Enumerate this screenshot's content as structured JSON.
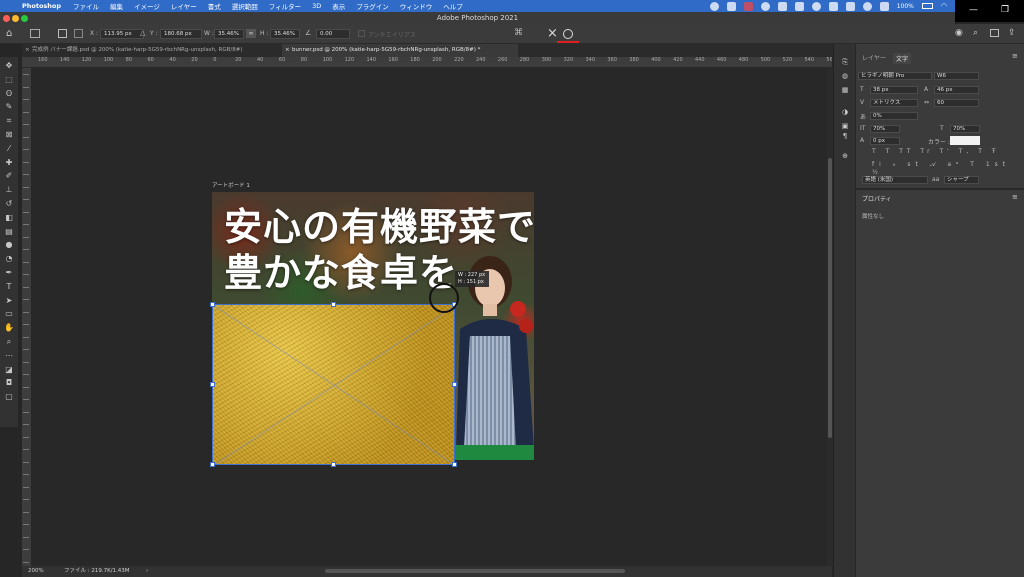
{
  "menubar": {
    "app": "Photoshop",
    "items": [
      "ファイル",
      "編集",
      "イメージ",
      "レイヤー",
      "書式",
      "選択範囲",
      "フィルター",
      "3D",
      "表示",
      "プラグイン",
      "ウィンドウ",
      "ヘルプ"
    ],
    "battery": "100%",
    "battery_icon": "battery-icon",
    "wifi_icon": "wifi-icon"
  },
  "titlebar": {
    "title": "Adobe Photoshop 2021"
  },
  "options": {
    "x_label": "X :",
    "x_value": "113.95 px",
    "y_label": "Y :",
    "y_value": "180.68 px",
    "w_label": "W :",
    "w_value": "35.46%",
    "h_label": "H :",
    "h_value": "35.46%",
    "angle_value": "0.00",
    "antialias_label": "アンチエイリアス",
    "cancel_icon": "cancel-icon",
    "commit_icon": "commit-icon"
  },
  "tabs": [
    {
      "label": "完成例 バナー課題.psd @ 200% (katie-harp-5G59-rbchNRg-unsplash, RGB/8#)",
      "active": false
    },
    {
      "label": "bunner.psd @ 200% (katie-harp-5G59-rbchNRg-unsplash, RGB/8#) *",
      "active": true
    }
  ],
  "ruler": {
    "h_ticks": [
      "160",
      "140",
      "120",
      "100",
      "80",
      "60",
      "40",
      "20",
      "0",
      "20",
      "40",
      "60",
      "80",
      "100",
      "120",
      "140",
      "160",
      "180",
      "200",
      "220",
      "240",
      "260",
      "280",
      "300",
      "320",
      "340",
      "360",
      "380",
      "400",
      "420",
      "440",
      "460",
      "480",
      "500",
      "520",
      "540",
      "560"
    ]
  },
  "canvas": {
    "artboard_label": "アートボード 1",
    "headline_line1": "安心の有機野菜で",
    "headline_line2": "豊かな食卓を",
    "tooltip_w": "W : 227 px",
    "tooltip_h": "H : 151 px"
  },
  "status": {
    "zoom": "200%",
    "file_info": "ファイル : 219.7K/1.43M"
  },
  "char_panel": {
    "tab_layers": "レイヤー",
    "tab_text": "文字",
    "font_family": "ヒラギノ明朝 Pro",
    "font_style": "W6",
    "font_size": "38 px",
    "leading": "46 px",
    "kerning": "メトリクス",
    "tracking": "60",
    "tsume": "0%",
    "vscale": "70%",
    "hscale": "70%",
    "baseline": "0 px",
    "color_label": "カラー :",
    "color_value": "#f2f2f2",
    "type_buttons": [
      "T",
      "T",
      "TT",
      "Tr",
      "T'",
      "T,",
      "T",
      "Ŧ"
    ],
    "language": "英語 (米国)",
    "antialias": "シャープ"
  },
  "prop_panel": {
    "title": "プロパティ",
    "content": "属性なし"
  }
}
